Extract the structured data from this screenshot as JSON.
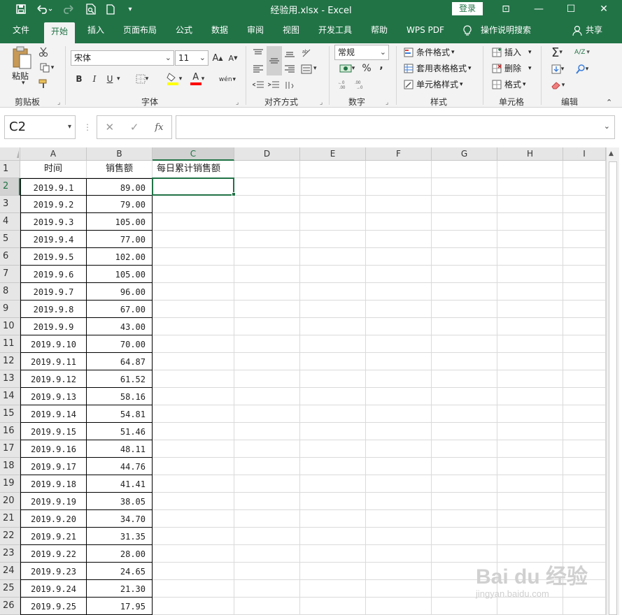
{
  "window": {
    "title": "经验用.xlsx  -  Excel",
    "login_label": "登录",
    "controls": {
      "restore_ribbon": "⊡",
      "minimize": "—",
      "maximize": "☐",
      "close": "✕"
    }
  },
  "quick_access": {
    "save": "save-icon",
    "undo": "undo-icon",
    "redo": "redo-icon",
    "print_preview": "print-preview-icon",
    "new": "new-document-icon",
    "customize": "customize-qat-icon"
  },
  "tabs": [
    {
      "label": "文件"
    },
    {
      "label": "开始",
      "active": true
    },
    {
      "label": "插入"
    },
    {
      "label": "页面布局"
    },
    {
      "label": "公式"
    },
    {
      "label": "数据"
    },
    {
      "label": "审阅"
    },
    {
      "label": "视图"
    },
    {
      "label": "开发工具"
    },
    {
      "label": "帮助"
    },
    {
      "label": "WPS PDF"
    }
  ],
  "tell_me": "操作说明搜索",
  "share": "共享",
  "ribbon": {
    "clipboard": {
      "paste": "粘贴",
      "label": "剪贴板"
    },
    "font": {
      "name": "宋体",
      "size": "11",
      "grow": "A",
      "shrink": "A",
      "bold": "B",
      "italic": "I",
      "underline": "U",
      "phonetic": "wén",
      "label": "字体",
      "font_color": "A"
    },
    "alignment": {
      "label": "对齐方式"
    },
    "number": {
      "format": "常规",
      "percent": "%",
      "comma": ",",
      "label": "数字"
    },
    "styles": {
      "conditional": "条件格式",
      "table": "套用表格格式",
      "cell": "单元格样式",
      "label": "样式"
    },
    "cells": {
      "insert": "插入",
      "delete": "删除",
      "format": "格式",
      "label": "单元格"
    },
    "editing": {
      "sum": "Σ",
      "sort": "A/Z",
      "label": "编辑"
    }
  },
  "formula_bar": {
    "name_box": "C2",
    "cancel": "✕",
    "enter": "✓",
    "fx": "fx",
    "value": ""
  },
  "columns": [
    "A",
    "B",
    "C",
    "D",
    "E",
    "F",
    "G",
    "H",
    "I"
  ],
  "selected_column": "C",
  "selected_row": "2",
  "header_row": {
    "a": "时间",
    "b": "销售额",
    "c": "每日累计销售额"
  },
  "rows": [
    {
      "n": "2",
      "date": "2019.9.1",
      "sales": "89.00"
    },
    {
      "n": "3",
      "date": "2019.9.2",
      "sales": "79.00"
    },
    {
      "n": "4",
      "date": "2019.9.3",
      "sales": "105.00"
    },
    {
      "n": "5",
      "date": "2019.9.4",
      "sales": "77.00"
    },
    {
      "n": "6",
      "date": "2019.9.5",
      "sales": "102.00"
    },
    {
      "n": "7",
      "date": "2019.9.6",
      "sales": "105.00"
    },
    {
      "n": "8",
      "date": "2019.9.7",
      "sales": "96.00"
    },
    {
      "n": "9",
      "date": "2019.9.8",
      "sales": "67.00"
    },
    {
      "n": "10",
      "date": "2019.9.9",
      "sales": "43.00"
    },
    {
      "n": "11",
      "date": "2019.9.10",
      "sales": "70.00"
    },
    {
      "n": "12",
      "date": "2019.9.11",
      "sales": "64.87"
    },
    {
      "n": "13",
      "date": "2019.9.12",
      "sales": "61.52"
    },
    {
      "n": "14",
      "date": "2019.9.13",
      "sales": "58.16"
    },
    {
      "n": "15",
      "date": "2019.9.14",
      "sales": "54.81"
    },
    {
      "n": "16",
      "date": "2019.9.15",
      "sales": "51.46"
    },
    {
      "n": "17",
      "date": "2019.9.16",
      "sales": "48.11"
    },
    {
      "n": "18",
      "date": "2019.9.17",
      "sales": "44.76"
    },
    {
      "n": "19",
      "date": "2019.9.18",
      "sales": "41.41"
    },
    {
      "n": "20",
      "date": "2019.9.19",
      "sales": "38.05"
    },
    {
      "n": "21",
      "date": "2019.9.20",
      "sales": "34.70"
    },
    {
      "n": "22",
      "date": "2019.9.21",
      "sales": "31.35"
    },
    {
      "n": "23",
      "date": "2019.9.22",
      "sales": "28.00"
    },
    {
      "n": "24",
      "date": "2019.9.23",
      "sales": "24.65"
    },
    {
      "n": "25",
      "date": "2019.9.24",
      "sales": "21.30"
    },
    {
      "n": "26",
      "date": "2019.9.25",
      "sales": "17.95"
    }
  ],
  "watermark": {
    "brand": "Bai du 经验",
    "url": "jingyan.baidu.com"
  },
  "colors": {
    "accent": "#217346",
    "grid_line": "#dadada",
    "header_bg": "#e6e6e6"
  }
}
